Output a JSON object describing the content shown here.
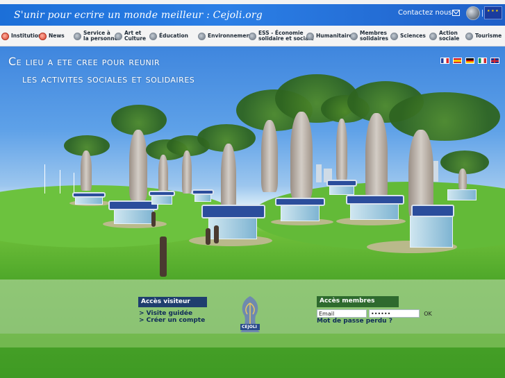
{
  "header": {
    "tagline": "S'unir pour ecrire un monde meilleur : Cejoli.org",
    "contact_label": "Contactez nous"
  },
  "nav": {
    "items": [
      {
        "label": "Institutions",
        "icon": "red"
      },
      {
        "label": "News",
        "icon": "red"
      },
      {
        "label": "Service à\nla personne",
        "icon": "gray"
      },
      {
        "label": "Art et\nCulture",
        "icon": "gray"
      },
      {
        "label": "Éducation",
        "icon": "gray"
      },
      {
        "label": "Environnement",
        "icon": "gray"
      },
      {
        "label": "ESS - Économie\nsolidaire et sociale",
        "icon": "gray"
      },
      {
        "label": "Humanitaire",
        "icon": "gray"
      },
      {
        "label": "Membres\nsolidaires",
        "icon": "gray"
      },
      {
        "label": "Sciences",
        "icon": "gray"
      },
      {
        "label": "Action\nsociale",
        "icon": "gray"
      },
      {
        "label": "Tourisme",
        "icon": "gray"
      }
    ]
  },
  "hero": {
    "line1": "Ce lieu a ete cree pour reunir",
    "line2": "les activites sociales et solidaires"
  },
  "languages": [
    "fr",
    "es",
    "de",
    "it",
    "en"
  ],
  "visitor": {
    "title": "Accès visiteur",
    "links": [
      "> Visite guidée",
      "> Créer un compte"
    ]
  },
  "members": {
    "title": "Accès membres",
    "email_value": "Email",
    "password_value": "••••••",
    "ok_label": "OK",
    "forgot_label": "Mot de passe perdu ?"
  },
  "logo": {
    "text": "CEJOLI"
  },
  "colors": {
    "header_blue": "#2b7fe6",
    "visitor_blue": "#1f3e6e",
    "members_green": "#2e6a2e",
    "grass": "#4fa82a"
  }
}
